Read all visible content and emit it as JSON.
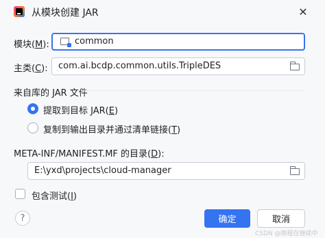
{
  "window": {
    "title": "从模块创建 JAR",
    "close_symbol": "✕"
  },
  "module": {
    "label_prefix": "模块(",
    "label_mnemonic": "M",
    "label_suffix": "):",
    "value": "common"
  },
  "main_class": {
    "label_prefix": "主类(",
    "label_mnemonic": "C",
    "label_suffix": "):",
    "value": "com.ai.bcdp.common.utils.TripleDES"
  },
  "library_jars": {
    "group_title": "来自库的 JAR 文件",
    "options": [
      {
        "label_prefix": "提取到目标 JAR(",
        "mnemonic": "E",
        "label_suffix": ")",
        "selected": true
      },
      {
        "label_prefix": "复制到输出目录并通过清单链接(",
        "mnemonic": "T",
        "label_suffix": ")",
        "selected": false
      }
    ]
  },
  "manifest": {
    "label_prefix": "META-INF/MANIFEST.MF 的目录(",
    "label_mnemonic": "D",
    "label_suffix": "):",
    "value": "E:\\yxd\\projects\\cloud-manager"
  },
  "include_tests": {
    "label_prefix": "包含测试(",
    "mnemonic": "I",
    "label_suffix": ")",
    "checked": false
  },
  "buttons": {
    "help": "?",
    "ok": "确定",
    "cancel": "取消"
  },
  "watermark": "CSDN @旅程在继续中"
}
